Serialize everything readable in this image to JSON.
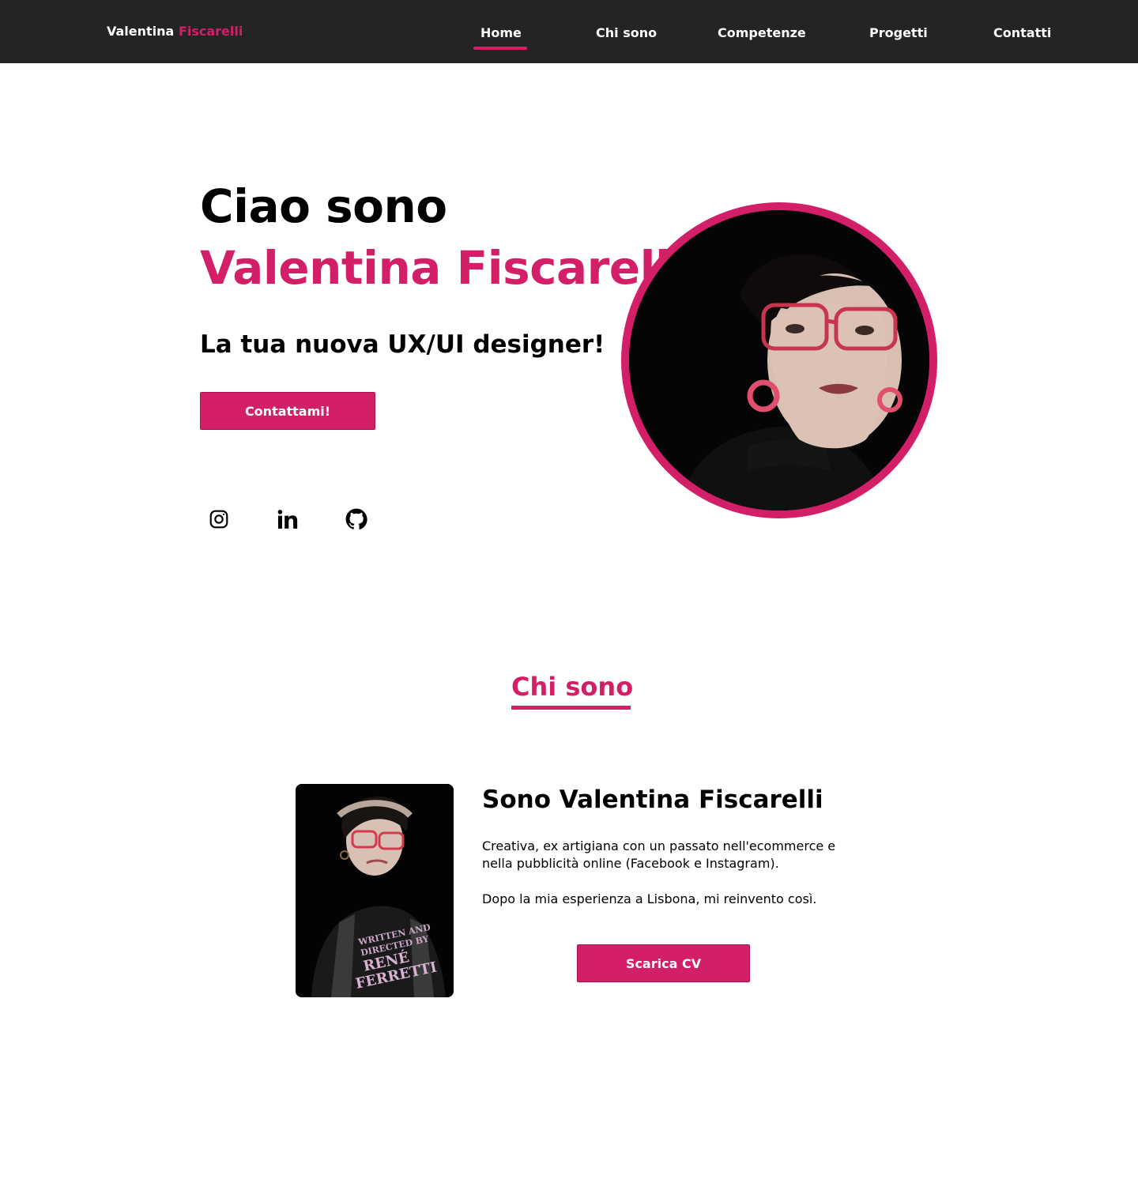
{
  "colors": {
    "accent": "#d21f68",
    "header_bg": "#242424",
    "text": "#000000",
    "background": "#ffffff"
  },
  "header": {
    "brand_first": "Valentina",
    "brand_last": "Fiscarelli",
    "nav": [
      {
        "label": "Home",
        "active": true
      },
      {
        "label": "Chi sono",
        "active": false
      },
      {
        "label": "Competenze",
        "active": false
      },
      {
        "label": "Progetti",
        "active": false
      },
      {
        "label": "Contatti",
        "active": false
      }
    ]
  },
  "hero": {
    "greeting": "Ciao sono",
    "name": "Valentina Fiscarelli",
    "tagline": "La tua nuova UX/UI designer!",
    "cta_label": "Contattami!",
    "social": [
      {
        "icon": "instagram-icon"
      },
      {
        "icon": "linkedin-icon"
      },
      {
        "icon": "github-icon"
      }
    ]
  },
  "about": {
    "section_title": "Chi sono",
    "heading": "Sono Valentina Fiscarelli",
    "paragraph1": "Creativa, ex artigiana con un passato nell'ecommerce e nella pubblicità online (Facebook e Instagram).",
    "paragraph2": "Dopo la mia esperienza a Lisbona, mi reinvento così.",
    "cv_button_label": "Scarica CV"
  }
}
